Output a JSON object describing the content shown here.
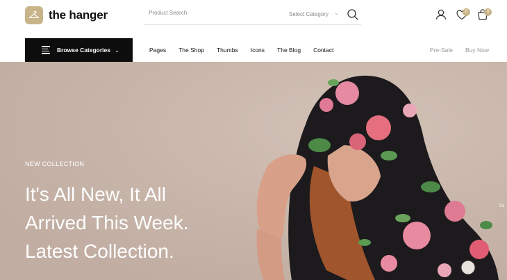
{
  "brand": {
    "name": "the hanger",
    "accent": "#c9b48a"
  },
  "search": {
    "placeholder": "Product Search",
    "category_label": "Select Category"
  },
  "header_icons": {
    "wishlist_count": "0",
    "cart_count": "0"
  },
  "navbar": {
    "browse_label": "Browse Categories",
    "links": [
      "Pages",
      "The Shop",
      "Thumbs",
      "Icons",
      "The Blog",
      "Contact"
    ],
    "right_links": [
      "Pre-Sale",
      "Buy Now"
    ]
  },
  "hero": {
    "eyebrow": "NEW COLLECTION",
    "title_lines": [
      "It's All New, It All",
      "Arrived This Week.",
      "Latest Collection."
    ],
    "slide_number": "01",
    "background": "#c6b3a8"
  }
}
